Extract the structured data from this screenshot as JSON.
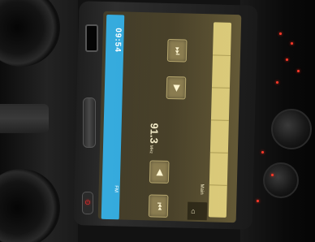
{
  "status_bar": {
    "time": "09:54",
    "source_label": "FM"
  },
  "radio": {
    "frequency": "91.3",
    "unit": "MHz"
  },
  "controls": {
    "next_station": "⏭",
    "seek_up": "▶",
    "seek_down": "◀",
    "prev_station": "⏮"
  },
  "side_menu": {
    "items": [
      "",
      "",
      "",
      "",
      "",
      ""
    ]
  },
  "bottom_bar": {
    "main_label": "Main",
    "home_icon": "⌂"
  },
  "hardware": {
    "power_icon": "⏻"
  },
  "colors": {
    "status_bar": "#2fa8dc",
    "screen_bg": "#4a422a",
    "menu_bg": "#d8c878",
    "button_bg": "#8a7c50",
    "indicator_led": "#ff3a2a"
  }
}
